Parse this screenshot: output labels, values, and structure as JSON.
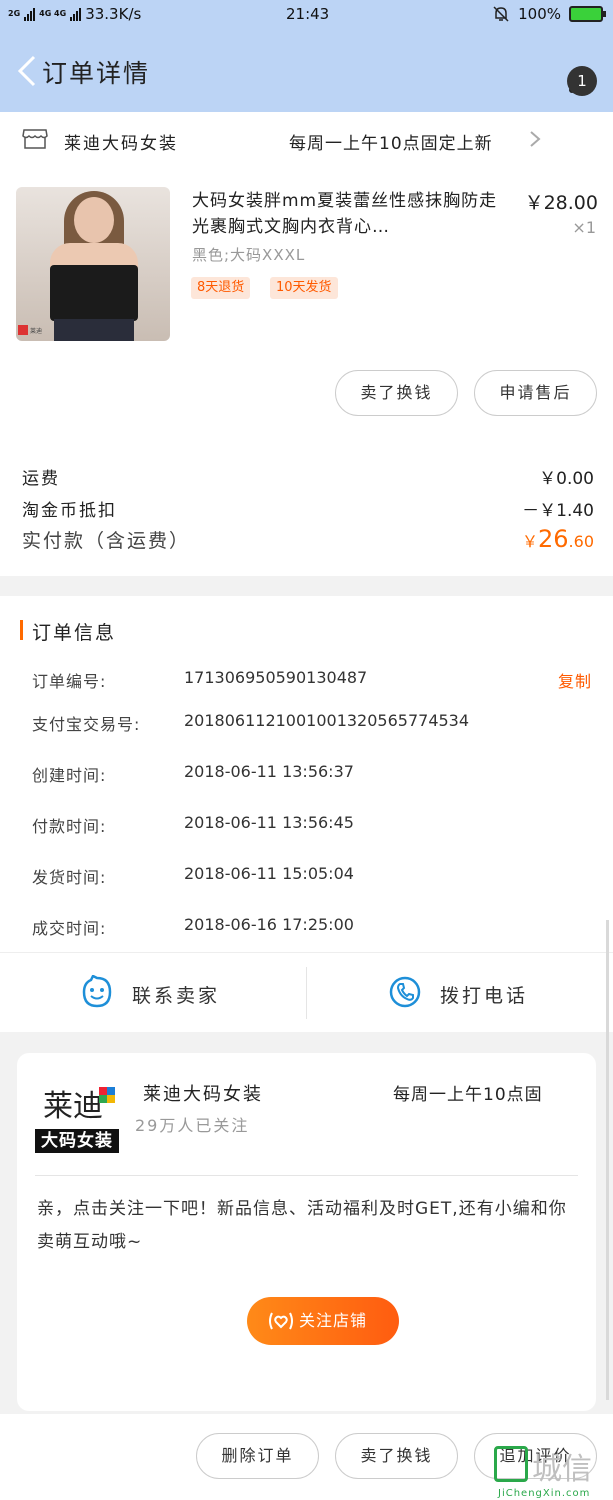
{
  "status_bar": {
    "network_a": "2G",
    "network_b": "4G 4G",
    "speed": "33.3K/s",
    "time": "21:43",
    "battery": "100%",
    "icons": [
      "signal-icon",
      "mute-bell-icon",
      "battery-icon"
    ]
  },
  "nav": {
    "title": "订单详情",
    "badge_count": "1",
    "back_icon": "chevron-left-icon",
    "more_icon": "more-vertical-icon"
  },
  "shop": {
    "name": "莱迪大码女装",
    "notice": "每周一上午10点固定上新"
  },
  "product": {
    "title": "大码女装胖mm夏装蕾丝性感抹胸防走光裹胸式文胸内衣背心…",
    "price": "￥28.00",
    "qty": "×1",
    "sku": "黑色;大码XXXL",
    "tags": [
      "8天退货",
      "10天发货"
    ],
    "image_logo_text": "莱迪",
    "sell_label": "卖了换钱",
    "after_sale_label": "申请售后"
  },
  "fees": {
    "shipping_label": "运费",
    "shipping_value": "￥0.00",
    "coin_label": "淘金币抵扣",
    "coin_value": "－￥1.40",
    "paid_label": "实付款（含运费）",
    "paid_prefix": "￥",
    "paid_int": "26",
    "paid_dec": ".60"
  },
  "order_info": {
    "section_title": "订单信息",
    "copy_label": "复制",
    "rows": [
      {
        "key": "订单编号:",
        "value": "171306950590130487"
      },
      {
        "key": "支付宝交易号:",
        "value": "2018061121001001320565774534"
      },
      {
        "key": "创建时间:",
        "value": "2018-06-11 13:56:37"
      },
      {
        "key": "付款时间:",
        "value": "2018-06-11 13:56:45"
      },
      {
        "key": "发货时间:",
        "value": "2018-06-11 15:05:04"
      },
      {
        "key": "成交时间:",
        "value": "2018-06-16 17:25:00"
      }
    ]
  },
  "contact": {
    "seller_label": "联系卖家",
    "phone_label": "拨打电话"
  },
  "store_card": {
    "logo_top": "莱迪",
    "logo_band": "大码女装",
    "name": "莱迪大码女装",
    "followers": "29万人已关注",
    "notice": "每周一上午10点固",
    "desc": "亲，点击关注一下吧！新品信息、活动福利及时GET,还有小编和你卖萌互动哦~",
    "follow_label": "关注店铺"
  },
  "bottom": {
    "delete_label": "删除订单",
    "sell_label": "卖了换钱",
    "review_label": "追加评价"
  },
  "watermark": {
    "text": "城信",
    "url": "JiChengXin.com"
  },
  "colors": {
    "header_bg": "#bcd4f5",
    "accent": "#ff6a00",
    "tag_bg": "#fde6d9",
    "icon_blue": "#1e8fd8"
  }
}
